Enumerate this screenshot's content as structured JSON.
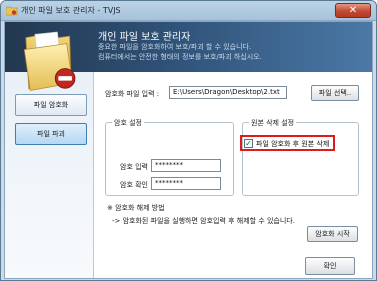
{
  "window": {
    "title": "개인 파일 보호 관리자 - TVJS",
    "close_glyph": "✕"
  },
  "header": {
    "title": "개인 파일 보호 관리자",
    "desc_line1": "중요한 파일을 암호화하여 보호/파괴 할 수 있습니다.",
    "desc_line2": "컴퓨터에서는 안전한 형태의 정보를 보호/파괴 하십시오."
  },
  "sidebar": {
    "items": [
      {
        "label": "파일 암호화"
      },
      {
        "label": "파일 파괴"
      }
    ]
  },
  "form": {
    "file_label": "암호화 파일 입력 :",
    "file_path": "E:\\Users\\Dragon\\Desktop\\2.txt",
    "file_button": "파일 선택..",
    "password_group_title": "암호 설정",
    "password_label": "암호 입력 :",
    "password_value": "********",
    "confirm_label": "암호 확인 :",
    "confirm_value": "********",
    "delete_group_title": "원본 삭제 설정",
    "delete_checkbox_label": "파일 암호화 후 원본 삭제",
    "delete_checked": true,
    "decrypt_note_title": "※ 암호화 해제 방법",
    "decrypt_note_text": "-> 암호화된 파일을 실행하면 암호입력 후 해제할 수 있습니다.",
    "start_button": "암호화 시작",
    "ok_button": "확인"
  },
  "icons": {
    "app": "folder-lock-icon",
    "folder": "folder-icon",
    "badge": "no-entry-icon"
  },
  "colors": {
    "header_band": "#2f5278",
    "highlight_box": "#e0191d",
    "close_button": "#c24a33"
  }
}
